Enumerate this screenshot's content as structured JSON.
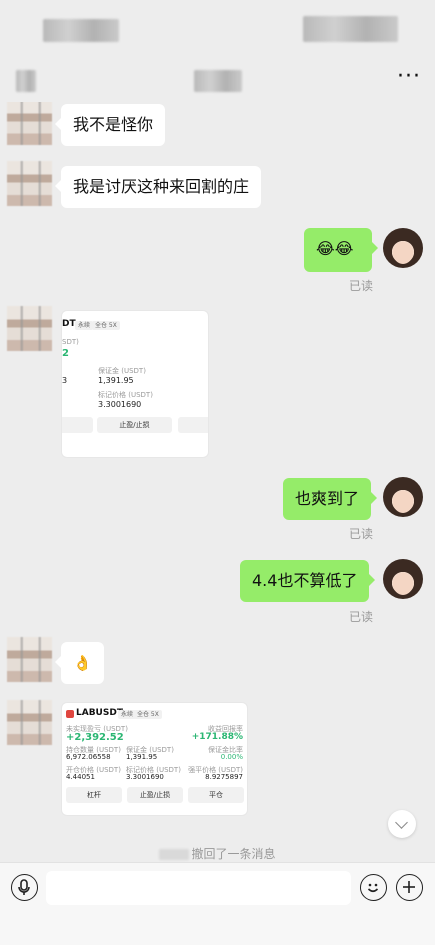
{
  "header": {
    "more_label": "···"
  },
  "messages": {
    "m1": "我不是怪你",
    "m2": "我是讨厌这种来回割的庄",
    "m3": "😂😂",
    "m4": "也爽到了",
    "m5": "4.4也不算低了",
    "m6": "👌",
    "read": "已读"
  },
  "card1": {
    "sym_tail": "DT",
    "tag1": "永续",
    "tag2": "全仓 5X",
    "col1": "SDT)",
    "val_pnl": "2",
    "lbl_margin": "保证金 (USDT)",
    "val_margin": "1,391.95",
    "lbl_mark": "标记价格 (USDT)",
    "val_mark": "3.3001690",
    "left_val": "3",
    "btn_mid": "止盈/止损"
  },
  "card2": {
    "symbol": "LABUSDT",
    "tag1": "永续",
    "tag2": "全仓 5X",
    "lbl_unreal": "未实现盈亏 (USDT)",
    "val_unreal": "+2,392.52",
    "lbl_roi": "收益回报率",
    "val_roi": "+171.88%",
    "lbl_qty": "持仓数量 (USDT)",
    "val_qty": "6,972.06558",
    "lbl_margin": "保证金 (USDT)",
    "val_margin": "1,391.95",
    "lbl_ratio": "保证金比率",
    "val_ratio": "0.00%",
    "lbl_open": "开仓价格 (USDT)",
    "val_open": "4.44051",
    "lbl_mark": "标记价格 (USDT)",
    "val_mark": "3.3001690",
    "lbl_liq": "强平价格 (USDT)",
    "val_liq": "8.9275897",
    "btn1": "杠杆",
    "btn2": "止盈/止损",
    "btn3": "平仓"
  },
  "recall_text": "撤回了一条消息",
  "colors": {
    "bubble_right": "#95ec69",
    "bubble_left": "#ffffff",
    "background": "#ededed",
    "profit": "#2bb673"
  },
  "icons": [
    "voice-icon",
    "emoji-icon",
    "plus-icon",
    "more-icon",
    "scroll-down-icon"
  ]
}
